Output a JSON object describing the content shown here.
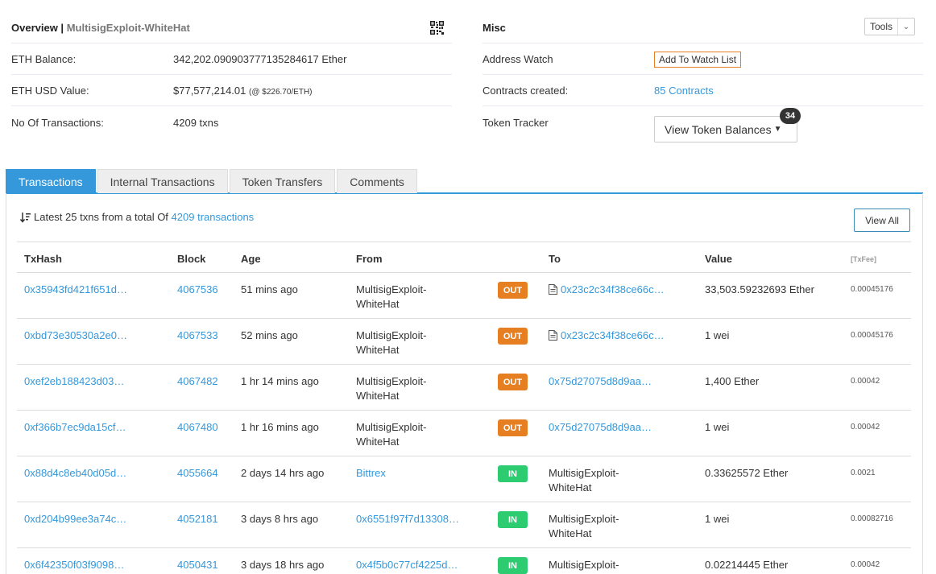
{
  "overview": {
    "title": "Overview |",
    "account": "MultisigExploit-WhiteHat",
    "rows": [
      {
        "label": "ETH Balance:",
        "value": "342,202.090903777135284617 Ether"
      },
      {
        "label": "ETH USD Value:",
        "value": "$77,577,214.01",
        "note": "(@ $226.70/ETH)"
      },
      {
        "label": "No Of Transactions:",
        "value": "4209 txns"
      }
    ]
  },
  "misc": {
    "title": "Misc",
    "tools_label": "Tools",
    "address_watch_label": "Address Watch",
    "watch_button": "Add To Watch List",
    "contracts_label": "Contracts created:",
    "contracts_value": "85 Contracts",
    "token_tracker_label": "Token Tracker",
    "token_button": "View Token Balances",
    "token_count": "34"
  },
  "tabs": [
    "Transactions",
    "Internal Transactions",
    "Token Transfers",
    "Comments"
  ],
  "summary": {
    "prefix": "Latest 25 txns from a total Of",
    "link": "4209 transactions",
    "view_all": "View All"
  },
  "table": {
    "headers": {
      "hash": "TxHash",
      "block": "Block",
      "age": "Age",
      "from": "From",
      "to": "To",
      "value": "Value",
      "fee": "[TxFee]"
    },
    "rows": [
      {
        "hash": "0x35943fd421f651d…",
        "block": "4067536",
        "age": "51 mins ago",
        "from": "MultisigExploit-WhiteHat",
        "from_link": false,
        "dir": "OUT",
        "to": "0x23c2c34f38ce66c…",
        "to_contract": true,
        "to_link": true,
        "value": "33,503.59232693 Ether",
        "fee": "0.00045176"
      },
      {
        "hash": "0xbd73e30530a2e0…",
        "block": "4067533",
        "age": "52 mins ago",
        "from": "MultisigExploit-WhiteHat",
        "from_link": false,
        "dir": "OUT",
        "to": "0x23c2c34f38ce66c…",
        "to_contract": true,
        "to_link": true,
        "value": "1 wei",
        "fee": "0.00045176"
      },
      {
        "hash": "0xef2eb188423d03…",
        "block": "4067482",
        "age": "1 hr 14 mins ago",
        "from": "MultisigExploit-WhiteHat",
        "from_link": false,
        "dir": "OUT",
        "to": "0x75d27075d8d9aa…",
        "to_contract": false,
        "to_link": true,
        "value": "1,400 Ether",
        "fee": "0.00042"
      },
      {
        "hash": "0xf366b7ec9da15cf…",
        "block": "4067480",
        "age": "1 hr 16 mins ago",
        "from": "MultisigExploit-WhiteHat",
        "from_link": false,
        "dir": "OUT",
        "to": "0x75d27075d8d9aa…",
        "to_contract": false,
        "to_link": true,
        "value": "1 wei",
        "fee": "0.00042"
      },
      {
        "hash": "0x88d4c8eb40d05d…",
        "block": "4055664",
        "age": "2 days 14 hrs ago",
        "from": "Bittrex",
        "from_link": true,
        "dir": "IN",
        "to": "MultisigExploit-WhiteHat",
        "to_contract": false,
        "to_link": false,
        "value": "0.33625572 Ether",
        "fee": "0.0021"
      },
      {
        "hash": "0xd204b99ee3a74c…",
        "block": "4052181",
        "age": "3 days 8 hrs ago",
        "from": "0x6551f97f7d13308…",
        "from_link": true,
        "dir": "IN",
        "to": "MultisigExploit-WhiteHat",
        "to_contract": false,
        "to_link": false,
        "value": "1 wei",
        "fee": "0.00082716"
      },
      {
        "hash": "0x6f42350f03f9098…",
        "block": "4050431",
        "age": "3 days 18 hrs ago",
        "from": "0x4f5b0c77cf4225d…",
        "from_link": true,
        "dir": "IN",
        "to": "MultisigExploit-WhiteHat",
        "to_contract": false,
        "to_link": false,
        "value": "0.02214445 Ether",
        "fee": "0.00042"
      }
    ]
  },
  "colors": {
    "accent": "#3498db",
    "out": "#e67e22",
    "in": "#2ecc71"
  }
}
